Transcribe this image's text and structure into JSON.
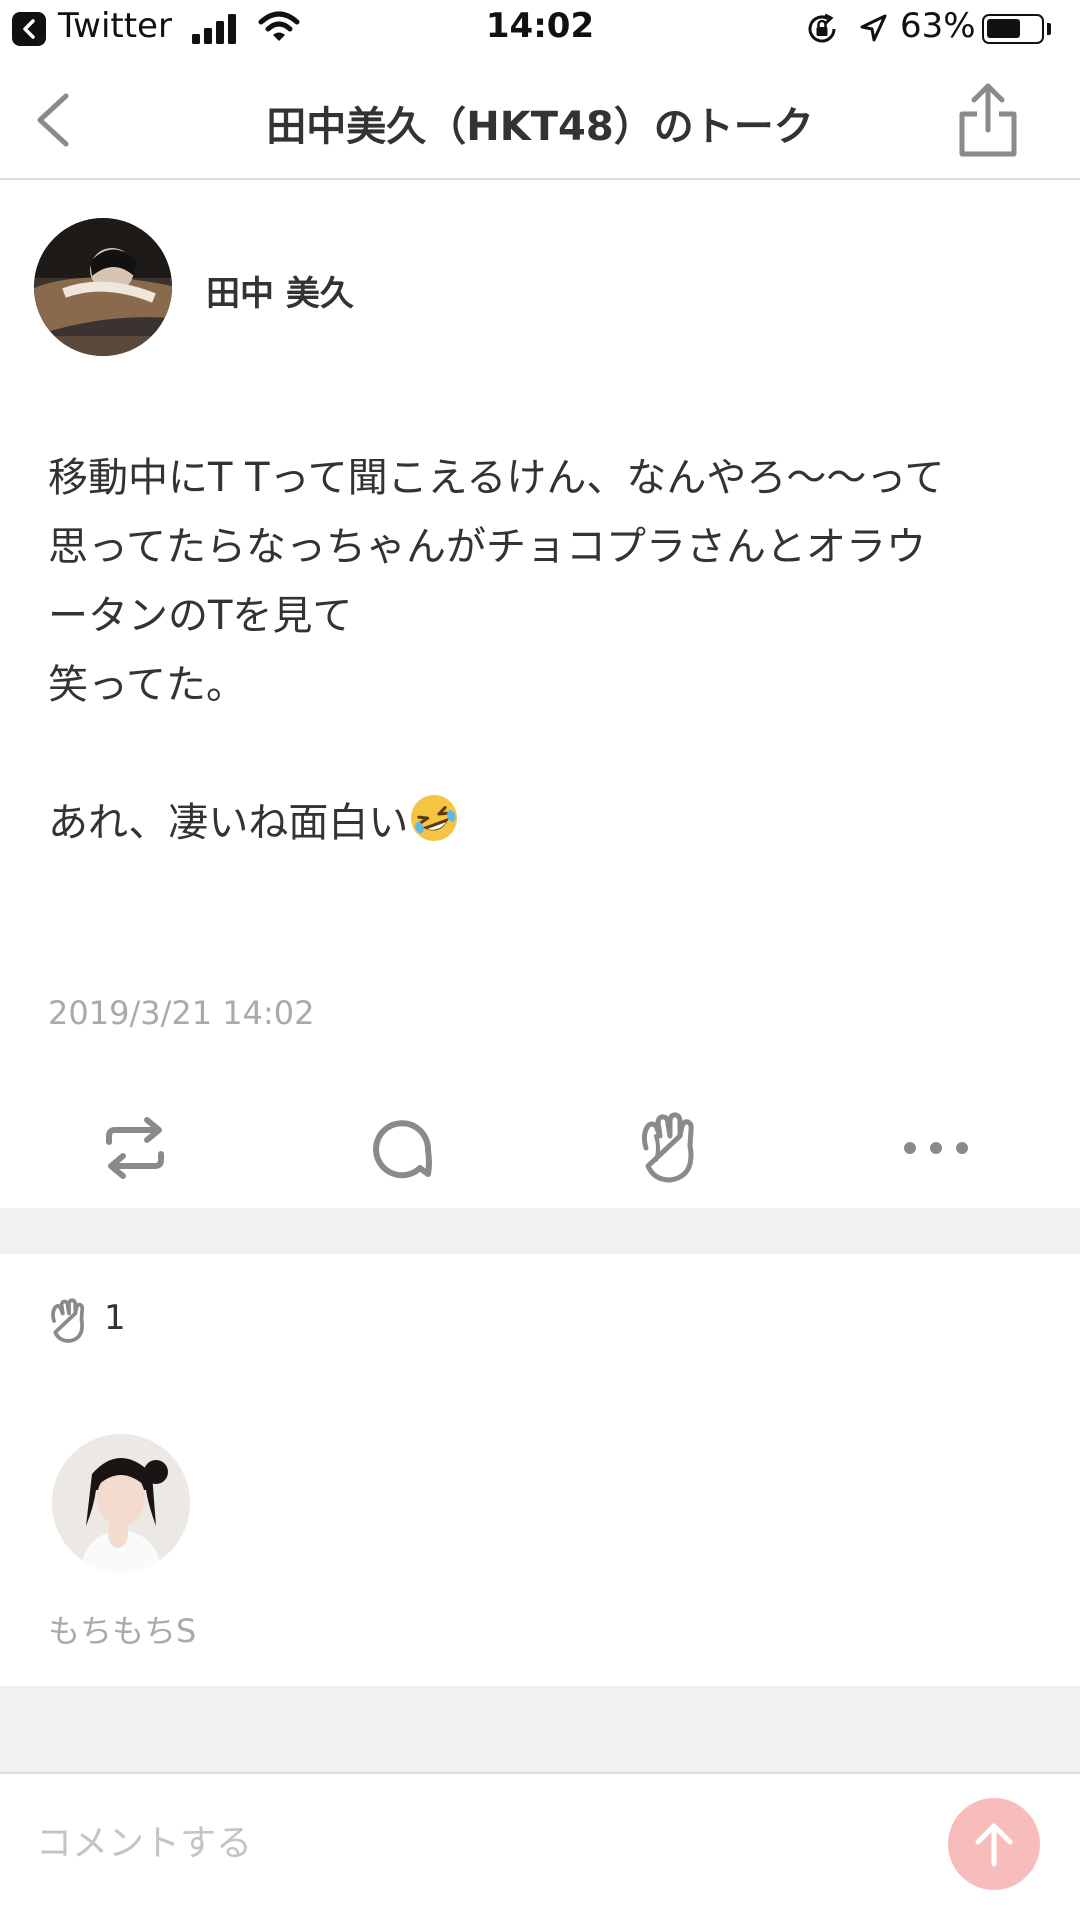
{
  "status_bar": {
    "back_app": "Twitter",
    "time": "14:02",
    "battery_percent": "63%",
    "battery_level": 0.63
  },
  "nav": {
    "title": "田中美久（HKT48）のトーク"
  },
  "post": {
    "author": "田中 美久",
    "body": "移動中にT Tって聞こえるけん、なんやろ〜〜って\n思ってたらなっちゃんがチョコプラさんとオラウ\nータンのTを見て\n笑ってた。\n\nあれ、凄いね面白い",
    "body_emoji": "rolling-on-floor-laughing-emoji",
    "timestamp": "2019/3/21 14:02"
  },
  "actions": {
    "icons": [
      "repost-icon",
      "comment-icon",
      "clap-icon",
      "more-icon"
    ]
  },
  "reactions": {
    "clap_count": "1",
    "reactor_name": "もちもちS"
  },
  "comment": {
    "placeholder": "コメントする"
  },
  "colors": {
    "accent": "#f7bdbd",
    "muted_text": "#aaaaaa",
    "divider": "#dcdcdc",
    "section_gap": "#f1f1f1",
    "icon_gray": "#8a8a8a"
  }
}
